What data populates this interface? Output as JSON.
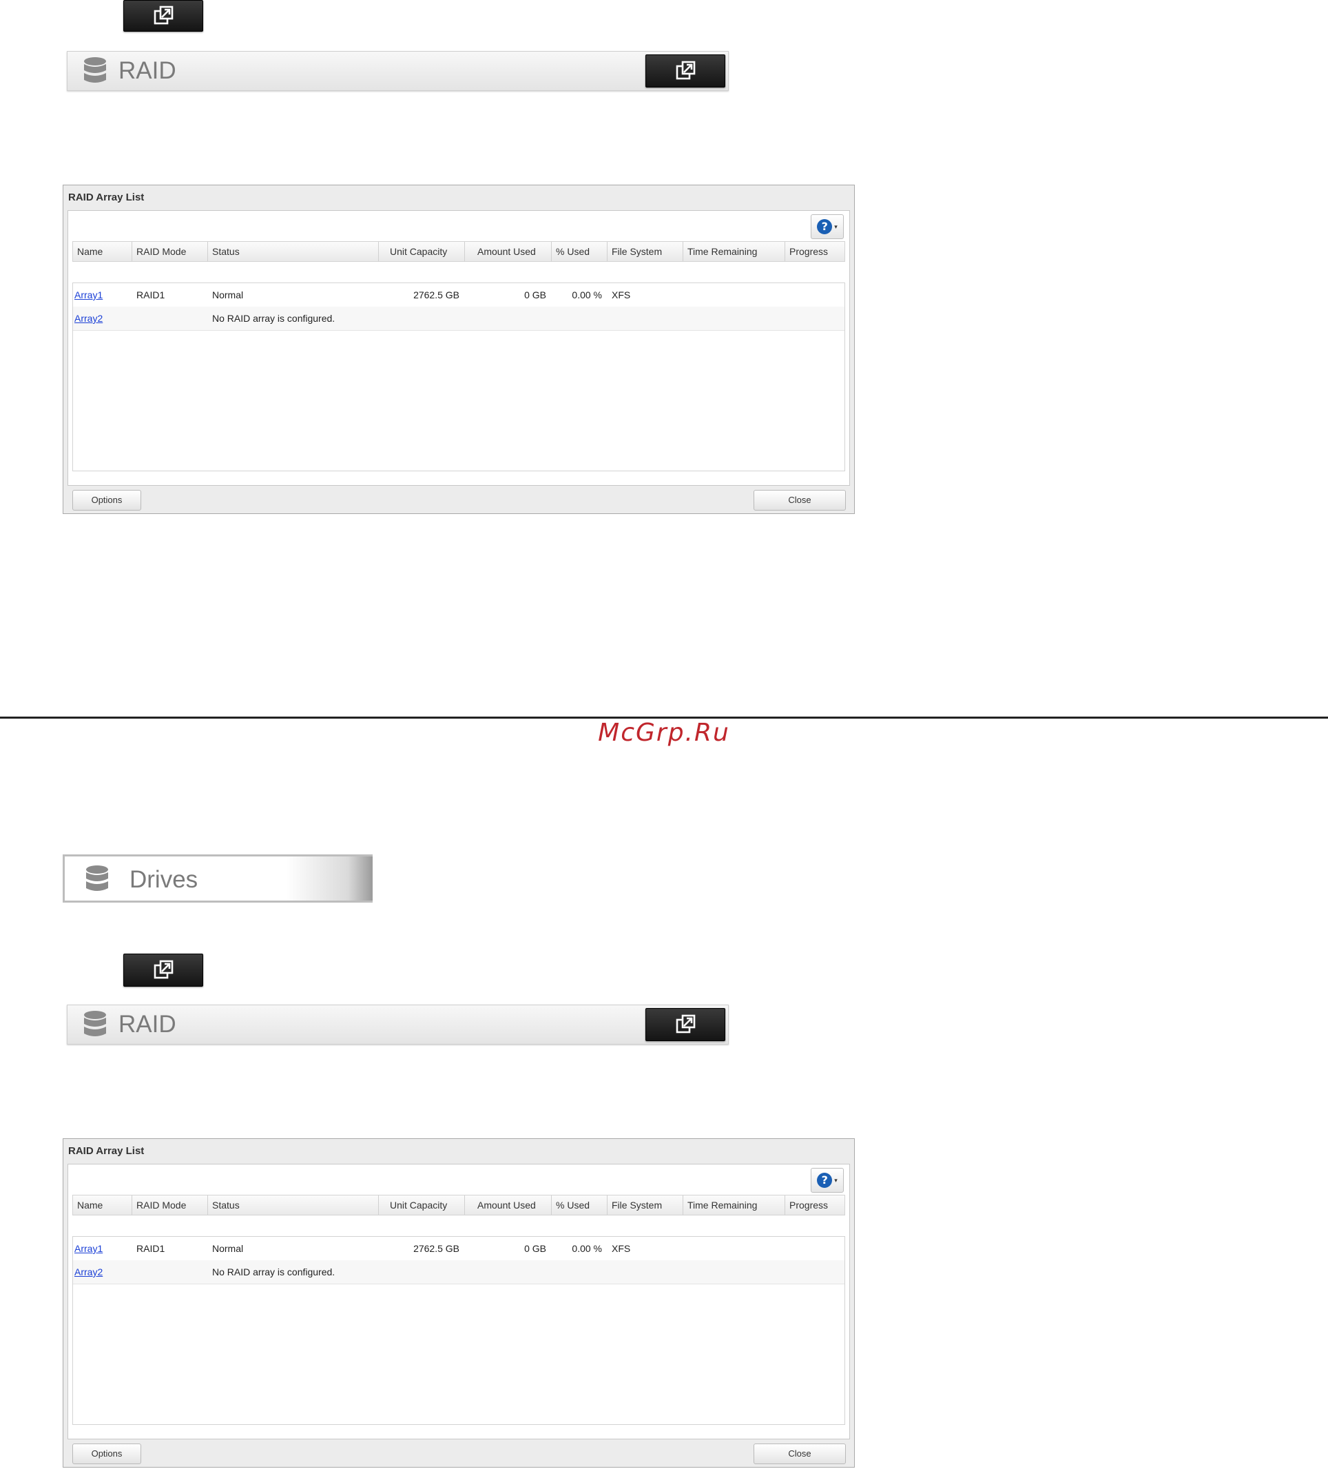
{
  "icons": {
    "external": "external-link-icon",
    "database": "database-icon",
    "help": "help-icon"
  },
  "colors": {
    "link": "#1a3fd6",
    "help_circle": "#1a5fb4",
    "watermark": "#c0262c"
  },
  "watermark": "McGrp.Ru",
  "drives": {
    "title": "Drives"
  },
  "raid_bar": {
    "title": "RAID"
  },
  "raid_window": {
    "title": "RAID Array List",
    "help_symbol": "?",
    "help_dropdown": "▾",
    "columns": [
      "Name",
      "RAID Mode",
      "Status",
      "Unit Capacity",
      "Amount Used",
      "% Used",
      "File System",
      "Time Remaining",
      "Progress"
    ],
    "rows": [
      {
        "name": "Array1",
        "mode": "RAID1",
        "status": "Normal",
        "capacity": "2762.5 GB",
        "used": "0 GB",
        "pct": "0.00 %",
        "fs": "XFS",
        "time": "",
        "progress": ""
      },
      {
        "name": "Array2",
        "mode": "",
        "status": "No RAID array is configured.",
        "capacity": "",
        "used": "",
        "pct": "",
        "fs": "",
        "time": "",
        "progress": ""
      }
    ],
    "options_label": "Options",
    "close_label": "Close"
  }
}
